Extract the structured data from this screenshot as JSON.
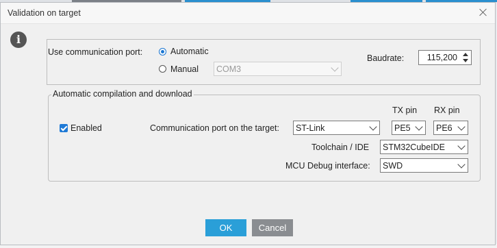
{
  "dialog": {
    "title": "Validation on target"
  },
  "port": {
    "label": "Use communication port:",
    "automatic_label": "Automatic",
    "manual_label": "Manual",
    "manual_value": "COM3",
    "baudrate_label": "Baudrate:",
    "baudrate_value": "115,200"
  },
  "group": {
    "title": "Automatic compilation and download",
    "enabled_label": "Enabled",
    "comm_port_label": "Communication port on the target:",
    "comm_port_value": "ST-Link",
    "tx_label": "TX pin",
    "tx_value": "PE5",
    "rx_label": "RX pin",
    "rx_value": "PE6",
    "toolchain_label": "Toolchain / IDE",
    "toolchain_value": "STM32CubeIDE",
    "debug_label": "MCU Debug interface:",
    "debug_value": "SWD"
  },
  "buttons": {
    "ok": "OK",
    "cancel": "Cancel"
  },
  "colors": {
    "ok": "#2a9fd8",
    "cancel": "#8a8d91",
    "accent": "#1a76d2"
  }
}
